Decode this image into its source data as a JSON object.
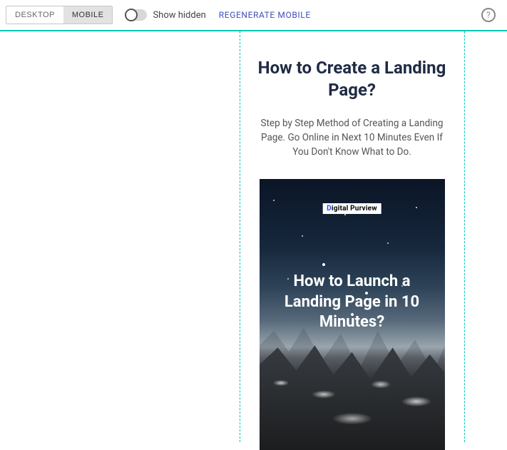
{
  "toolbar": {
    "view": {
      "desktop": "DESKTOP",
      "mobile": "MOBILE",
      "active": "mobile"
    },
    "show_hidden_label": "Show hidden",
    "regenerate_label": "REGENERATE MOBILE",
    "help_glyph": "?"
  },
  "preview": {
    "headline": "How to Create a Landing Page?",
    "subtext": "Step by Step Method of Creating a Landing Page. Go Online in Next 10 Minutes Even If You Don't Know What to Do.",
    "hero": {
      "logo_accent": "D",
      "logo_rest": "igital Purview",
      "headline": "How to Launch a Landing Page in 10 Minutes?"
    }
  }
}
